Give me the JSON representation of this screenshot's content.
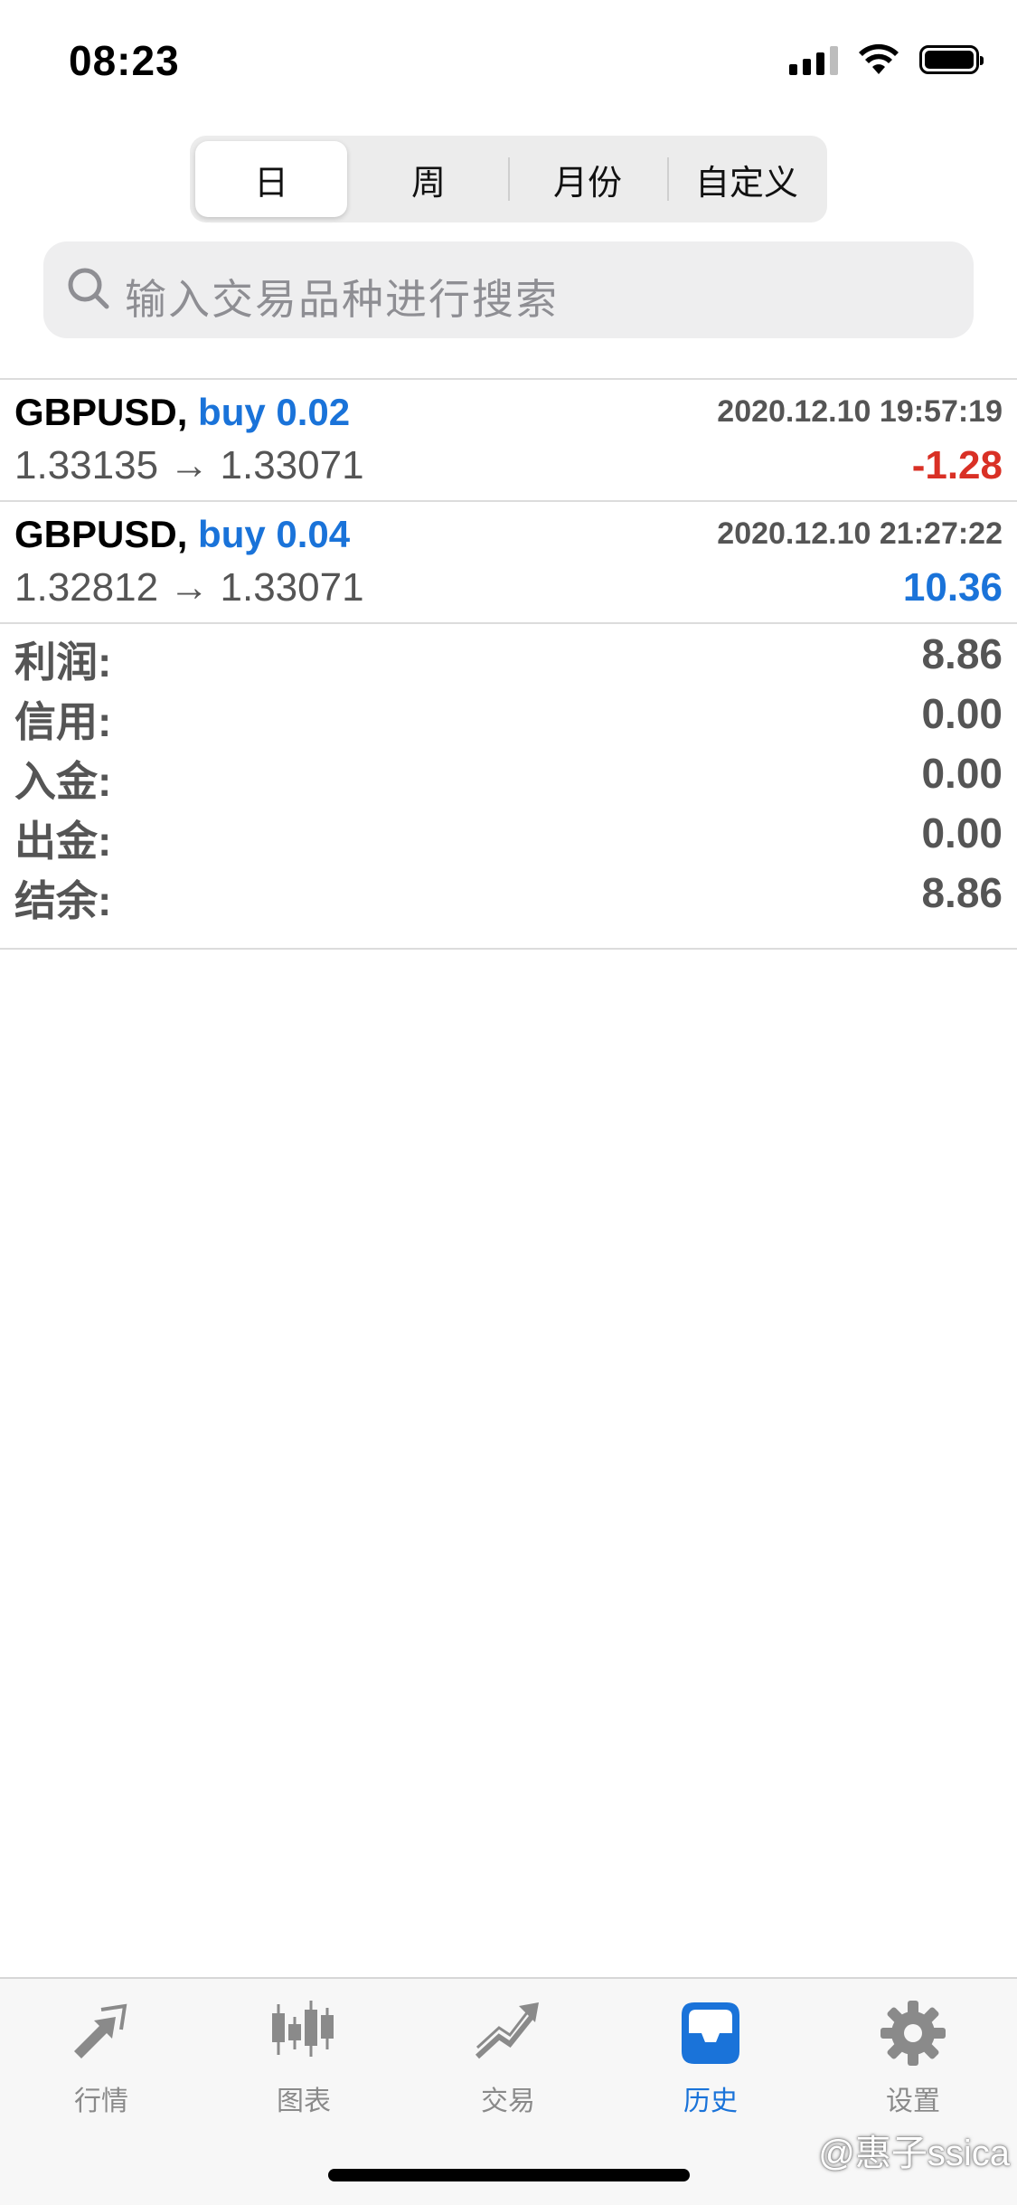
{
  "status_bar": {
    "time": "08:23"
  },
  "period_tabs": {
    "selected": "日",
    "items": [
      {
        "label": "日"
      },
      {
        "label": "周"
      },
      {
        "label": "月份"
      },
      {
        "label": "自定义"
      }
    ]
  },
  "search": {
    "placeholder": "输入交易品种进行搜索"
  },
  "deals": [
    {
      "symbol": "GBPUSD",
      "sep": ",",
      "side": "buy 0.02",
      "datetime": "2020.12.10 19:57:19",
      "prices": "1.33135 → 1.33071",
      "profit": "-1.28",
      "profit_color": "#d93025"
    },
    {
      "symbol": "GBPUSD",
      "sep": ",",
      "side": "buy 0.04",
      "datetime": "2020.12.10 21:27:22",
      "prices": "1.32812 → 1.33071",
      "profit": "10.36",
      "profit_color": "#1a73d9"
    }
  ],
  "summary": [
    {
      "label": "利润:",
      "value": "8.86"
    },
    {
      "label": "信用:",
      "value": "0.00"
    },
    {
      "label": "入金:",
      "value": "0.00"
    },
    {
      "label": "出金:",
      "value": "0.00"
    },
    {
      "label": "结余:",
      "value": "8.86"
    }
  ],
  "tabbar": {
    "selected": "历史",
    "items": [
      {
        "label": "行情",
        "icon": "quotes-arrows-icon"
      },
      {
        "label": "图表",
        "icon": "candlestick-chart-icon"
      },
      {
        "label": "交易",
        "icon": "trade-trend-icon"
      },
      {
        "label": "历史",
        "icon": "history-inbox-icon"
      },
      {
        "label": "设置",
        "icon": "gear-icon"
      }
    ]
  },
  "watermark": {
    "text": "@惠子ssica"
  },
  "colors": {
    "accent": "#1a73d9",
    "loss": "#d93025",
    "muted": "#555555",
    "tab_inactive": "#8a8a8a"
  }
}
